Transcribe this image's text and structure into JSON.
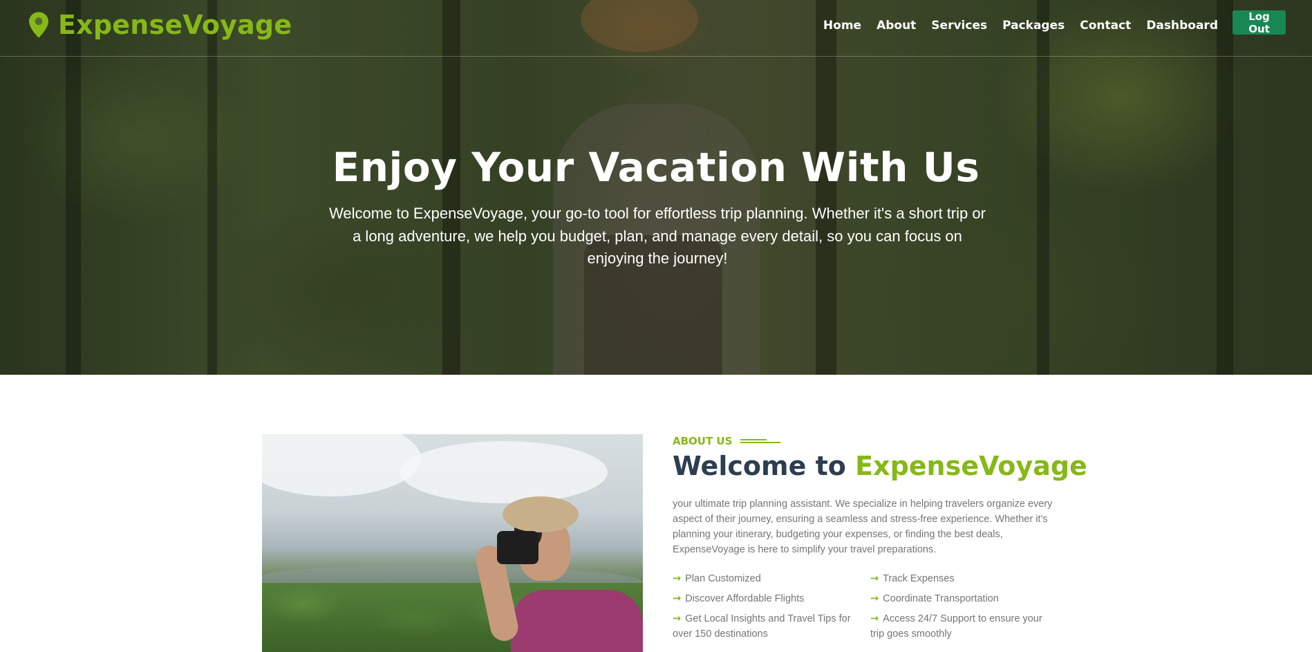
{
  "brand": {
    "name": "ExpenseVoyage",
    "icon": "map-pin-icon",
    "color": "#86b817"
  },
  "nav": {
    "links": [
      "Home",
      "About",
      "Services",
      "Packages",
      "Contact",
      "Dashboard"
    ],
    "logout_label": "Log Out",
    "logout_color": "#198754"
  },
  "hero": {
    "title": "Enjoy Your Vacation With Us",
    "subtitle": "Welcome to ExpenseVoyage, your go-to tool for effortless trip planning. Whether it's a short trip or a long adventure, we help you budget, plan, and manage every detail, so you can focus on enjoying the journey!"
  },
  "about": {
    "label": "ABOUT US",
    "title_prefix": "Welcome to ",
    "title_brand": "ExpenseVoyage",
    "text": "your ultimate trip planning assistant. We specialize in helping travelers organize every aspect of their journey, ensuring a seamless and stress-free experience. Whether it's planning your itinerary, budgeting your expenses, or finding the best deals, ExpenseVoyage is here to simplify your travel preparations.",
    "features": [
      "Plan Customized",
      "Track Expenses",
      "Discover Affordable Flights",
      "Coordinate Transportation",
      "Get Local Insights and Travel Tips for over 150 destinations",
      "Access 24/7 Support to ensure your trip goes smoothly"
    ],
    "feature_icon": "arrow-right-icon"
  }
}
